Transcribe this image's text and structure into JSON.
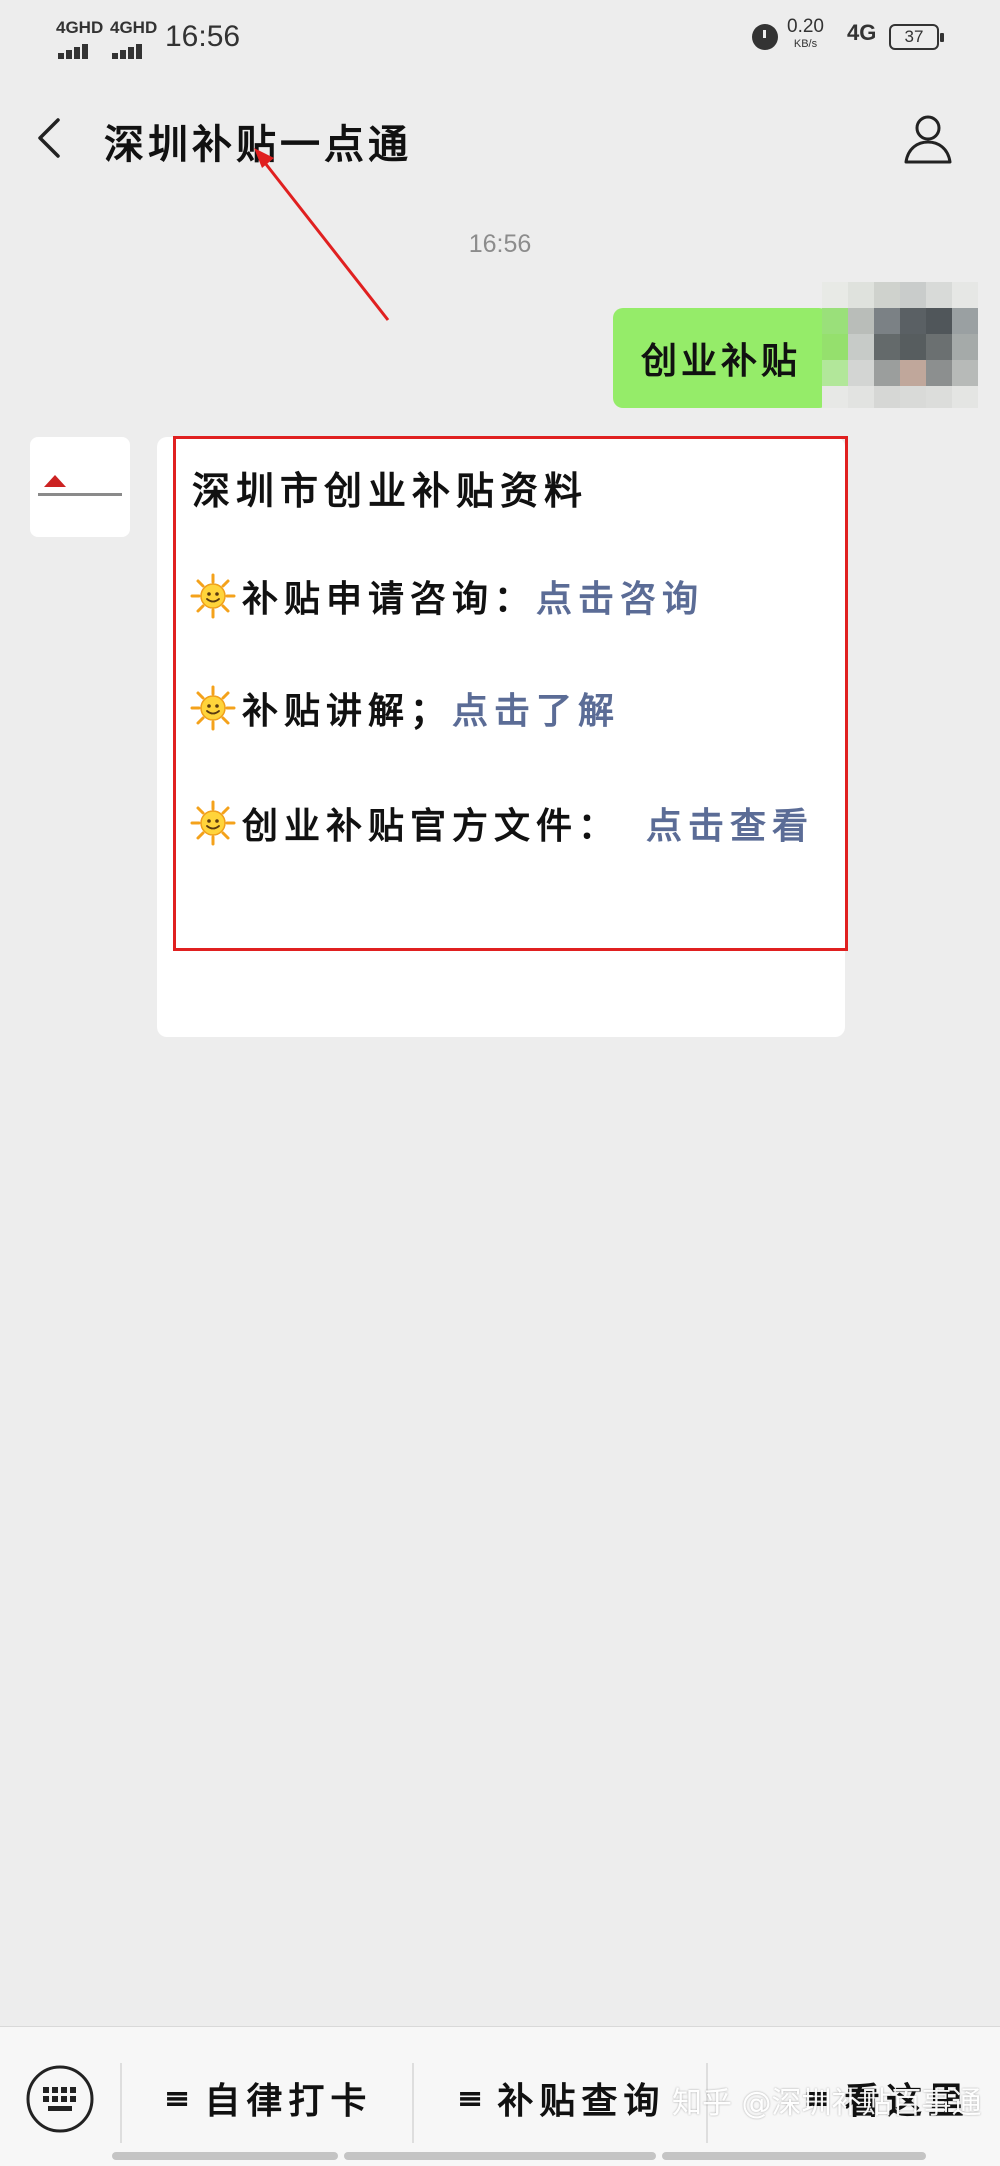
{
  "status_bar": {
    "signal_1": "4GHD",
    "signal_2": "4GHD",
    "time": "16:56",
    "net_speed": "0.20",
    "net_unit": "KB/s",
    "network": "4G",
    "battery": "37"
  },
  "header": {
    "title": "深圳补贴一点通"
  },
  "chat": {
    "timestamp": "16:56",
    "outgoing": "创业补贴",
    "card": {
      "title": "深圳市创业补贴资料",
      "rows": [
        {
          "label": "补贴申请咨询：",
          "link": "点击咨询"
        },
        {
          "label": "补贴讲解；",
          "link": "点击了解"
        },
        {
          "label": "创业补贴官方文件：",
          "link": "点击查看"
        }
      ]
    }
  },
  "bottom_menu": {
    "items": [
      "自律打卡",
      "补贴查询",
      "看这里"
    ]
  },
  "watermark": "知乎 @深圳补贴百事通",
  "colors": {
    "bubble_green": "#95ec69",
    "link_blue": "#5b6c96",
    "annotation_red": "#e02020"
  }
}
